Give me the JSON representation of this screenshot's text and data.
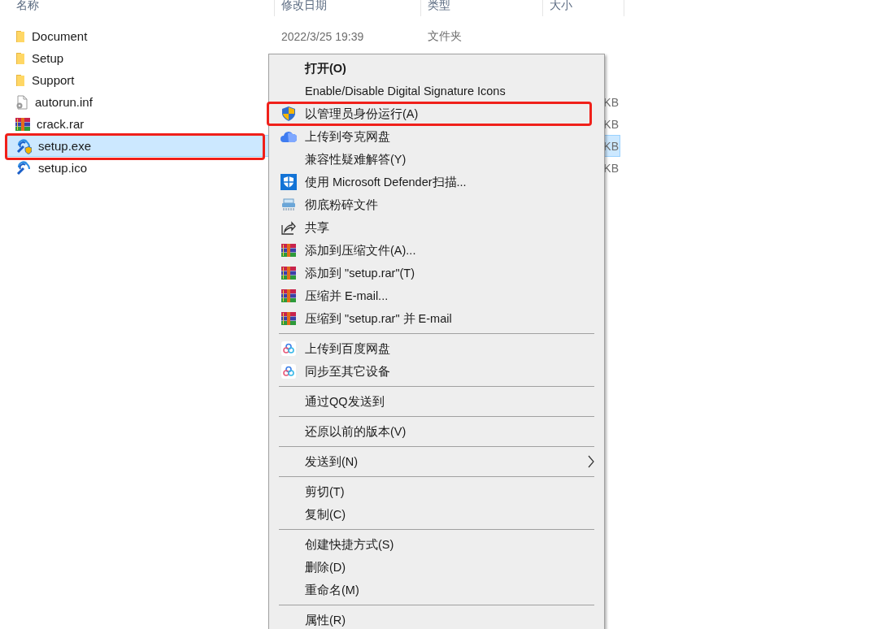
{
  "columns": [
    "名称",
    "修改日期",
    "类型",
    "大小"
  ],
  "files": [
    {
      "name": "Document",
      "kind": "folder",
      "date": "2022/3/25 19:39",
      "type": "文件夹",
      "selected": false,
      "highlighted": false
    },
    {
      "name": "Setup",
      "kind": "folder",
      "selected": false,
      "highlighted": false
    },
    {
      "name": "Support",
      "kind": "folder",
      "selected": false,
      "highlighted": false
    },
    {
      "name": "autorun.inf",
      "kind": "config",
      "size": "KB",
      "selected": false,
      "highlighted": false
    },
    {
      "name": "crack.rar",
      "kind": "rar",
      "size": "KB",
      "selected": false,
      "highlighted": false
    },
    {
      "name": "setup.exe",
      "kind": "exe",
      "size": "KB",
      "selected": true,
      "highlighted": true
    },
    {
      "name": "setup.ico",
      "kind": "ico",
      "size": "KB",
      "selected": false,
      "highlighted": false
    }
  ],
  "context_menu": [
    {
      "kind": "plain",
      "label": "打开(O)",
      "default": true,
      "submenu": false,
      "highlighted": false
    },
    {
      "kind": "plain",
      "label": "Enable/Disable Digital Signature Icons",
      "default": false,
      "submenu": false,
      "highlighted": false
    },
    {
      "kind": "shield",
      "label": "以管理员身份运行(A)",
      "default": false,
      "submenu": false,
      "highlighted": true
    },
    {
      "kind": "cloud",
      "label": "上传到夸克网盘",
      "default": false,
      "submenu": false,
      "highlighted": false
    },
    {
      "kind": "plain",
      "label": "兼容性疑难解答(Y)",
      "default": false,
      "submenu": false,
      "highlighted": false
    },
    {
      "kind": "defender",
      "label": "使用 Microsoft Defender扫描...",
      "default": false,
      "submenu": false,
      "highlighted": false
    },
    {
      "kind": "shredder",
      "label": "彻底粉碎文件",
      "default": false,
      "submenu": false,
      "highlighted": false
    },
    {
      "kind": "share",
      "label": "共享",
      "default": false,
      "submenu": false,
      "highlighted": false
    },
    {
      "kind": "archive",
      "label": "添加到压缩文件(A)...",
      "default": false,
      "submenu": false,
      "highlighted": false
    },
    {
      "kind": "archive",
      "label": "添加到 \"setup.rar\"(T)",
      "default": false,
      "submenu": false,
      "highlighted": false
    },
    {
      "kind": "archive",
      "label": "压缩并 E-mail...",
      "default": false,
      "submenu": false,
      "highlighted": false
    },
    {
      "kind": "archive",
      "label": "压缩到 \"setup.rar\" 并 E-mail",
      "default": false,
      "submenu": false,
      "highlighted": false
    },
    {
      "kind": "separator"
    },
    {
      "kind": "clouddisk",
      "label": "上传到百度网盘",
      "default": false,
      "submenu": false,
      "highlighted": false
    },
    {
      "kind": "clouddisk",
      "label": "同步至其它设备",
      "default": false,
      "submenu": false,
      "highlighted": false
    },
    {
      "kind": "separator"
    },
    {
      "kind": "plain",
      "label": "通过QQ发送到",
      "default": false,
      "submenu": false,
      "highlighted": false
    },
    {
      "kind": "separator"
    },
    {
      "kind": "plain",
      "label": "还原以前的版本(V)",
      "default": false,
      "submenu": false,
      "highlighted": false
    },
    {
      "kind": "separator"
    },
    {
      "kind": "plain",
      "label": "发送到(N)",
      "default": false,
      "submenu": true,
      "highlighted": false
    },
    {
      "kind": "separator"
    },
    {
      "kind": "plain",
      "label": "剪切(T)",
      "default": false,
      "submenu": false,
      "highlighted": false
    },
    {
      "kind": "plain",
      "label": "复制(C)",
      "default": false,
      "submenu": false,
      "highlighted": false
    },
    {
      "kind": "separator"
    },
    {
      "kind": "plain",
      "label": "创建快捷方式(S)",
      "default": false,
      "submenu": false,
      "highlighted": false
    },
    {
      "kind": "plain",
      "label": "删除(D)",
      "default": false,
      "submenu": false,
      "highlighted": false
    },
    {
      "kind": "plain",
      "label": "重命名(M)",
      "default": false,
      "submenu": false,
      "highlighted": false
    },
    {
      "kind": "separator"
    },
    {
      "kind": "plain",
      "label": "属性(R)",
      "default": false,
      "submenu": false,
      "highlighted": false
    }
  ]
}
